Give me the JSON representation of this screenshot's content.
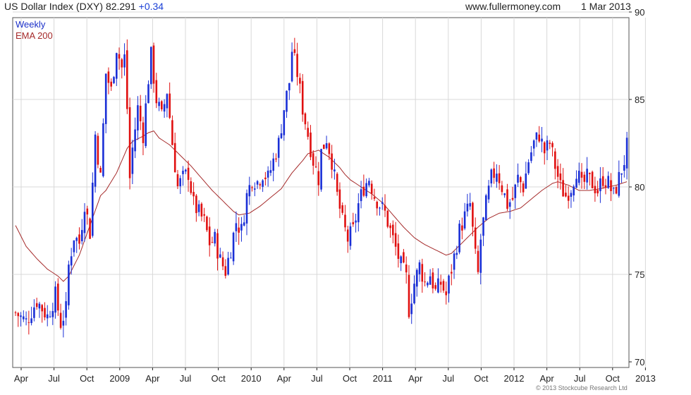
{
  "header": {
    "title": "US Dollar Index (DXY)",
    "last": "82.291",
    "change": "+0.34",
    "site": "www.fullermoney.com",
    "date": "1 Mar 2013"
  },
  "copyright": "© 2013 Stockcube Research Ltd",
  "colors": {
    "up": "#1a2fd6",
    "down": "#e01010",
    "ema": "#a52a2a",
    "grid": "#d8d8d8",
    "axis": "#222222"
  },
  "chart_data": {
    "type": "candlestick",
    "frequency": "Weekly",
    "legend": [
      "Weekly",
      "EMA 200"
    ],
    "ylim": [
      70,
      90
    ],
    "yticks": [
      70,
      75,
      80,
      85,
      90
    ],
    "xticks": [
      "Apr",
      "Jul",
      "Oct",
      "2009",
      "Apr",
      "Jul",
      "Oct",
      "2010",
      "Apr",
      "Jul",
      "Oct",
      "2011",
      "Apr",
      "Jul",
      "Oct",
      "2012",
      "Apr",
      "Jul",
      "Oct",
      "2013"
    ],
    "close_path": [
      [
        0,
        72.8
      ],
      [
        4,
        72.3
      ],
      [
        8,
        73.5
      ],
      [
        12,
        72.6
      ],
      [
        15,
        73.8
      ],
      [
        17,
        72.2
      ],
      [
        19,
        73.0
      ],
      [
        20,
        75.5
      ],
      [
        22,
        77.2
      ],
      [
        24,
        76.8
      ],
      [
        26,
        79.1
      ],
      [
        28,
        77.4
      ],
      [
        30,
        83.0
      ],
      [
        32,
        80.5
      ],
      [
        34,
        86.5
      ],
      [
        36,
        85.5
      ],
      [
        38,
        88.0
      ],
      [
        40,
        86.8
      ],
      [
        41,
        87.4
      ],
      [
        42,
        84.5
      ],
      [
        43,
        80.5
      ],
      [
        44,
        82.2
      ],
      [
        46,
        84.5
      ],
      [
        48,
        83.0
      ],
      [
        50,
        86.2
      ],
      [
        51,
        87.5
      ],
      [
        53,
        85.0
      ],
      [
        55,
        84.0
      ],
      [
        57,
        85.5
      ],
      [
        59,
        82.5
      ],
      [
        61,
        80.0
      ],
      [
        63,
        80.5
      ],
      [
        65,
        80.8
      ],
      [
        67,
        79.0
      ],
      [
        69,
        78.5
      ],
      [
        71,
        78.0
      ],
      [
        73,
        76.8
      ],
      [
        75,
        77.0
      ],
      [
        77,
        75.8
      ],
      [
        79,
        75.2
      ],
      [
        81,
        76.5
      ],
      [
        83,
        78.0
      ],
      [
        85,
        77.5
      ],
      [
        87,
        79.5
      ],
      [
        89,
        80.5
      ],
      [
        91,
        80.3
      ],
      [
        93,
        80.8
      ],
      [
        95,
        80.5
      ],
      [
        97,
        81.5
      ],
      [
        99,
        82.5
      ],
      [
        101,
        84.5
      ],
      [
        103,
        86.0
      ],
      [
        104,
        87.8
      ],
      [
        106,
        86.5
      ],
      [
        108,
        84.5
      ],
      [
        110,
        83.0
      ],
      [
        112,
        81.5
      ],
      [
        114,
        80.5
      ],
      [
        115,
        82.0
      ],
      [
        117,
        82.8
      ],
      [
        119,
        81.5
      ],
      [
        121,
        79.5
      ],
      [
        123,
        78.0
      ],
      [
        125,
        77.0
      ],
      [
        127,
        77.5
      ],
      [
        129,
        79.0
      ],
      [
        131,
        80.0
      ],
      [
        133,
        80.5
      ],
      [
        135,
        79.5
      ],
      [
        137,
        79.0
      ],
      [
        139,
        78.5
      ],
      [
        141,
        77.5
      ],
      [
        143,
        76.5
      ],
      [
        145,
        75.5
      ],
      [
        147,
        74.8
      ],
      [
        148,
        73.0
      ],
      [
        150,
        74.5
      ],
      [
        152,
        75.5
      ],
      [
        154,
        74.5
      ],
      [
        156,
        75.0
      ],
      [
        158,
        74.0
      ],
      [
        160,
        74.5
      ],
      [
        162,
        73.8
      ],
      [
        163,
        74.6
      ],
      [
        165,
        76.0
      ],
      [
        167,
        77.5
      ],
      [
        169,
        78.3
      ],
      [
        171,
        79.0
      ],
      [
        172,
        77.5
      ],
      [
        173,
        76.0
      ],
      [
        174,
        75.0
      ],
      [
        175,
        77.0
      ],
      [
        177,
        79.0
      ],
      [
        179,
        80.5
      ],
      [
        181,
        81.0
      ],
      [
        183,
        80.0
      ],
      [
        185,
        79.0
      ],
      [
        187,
        79.3
      ],
      [
        189,
        80.5
      ],
      [
        191,
        80.0
      ],
      [
        193,
        81.5
      ],
      [
        195,
        82.5
      ],
      [
        197,
        83.0
      ],
      [
        199,
        82.0
      ],
      [
        201,
        82.5
      ],
      [
        203,
        81.2
      ],
      [
        205,
        80.0
      ],
      [
        207,
        79.5
      ],
      [
        209,
        80.0
      ],
      [
        211,
        81.0
      ],
      [
        213,
        80.0
      ],
      [
        215,
        80.5
      ],
      [
        217,
        80.2
      ],
      [
        219,
        79.8
      ],
      [
        221,
        80.5
      ],
      [
        223,
        80.2
      ],
      [
        225,
        79.5
      ],
      [
        227,
        80.5
      ],
      [
        229,
        81.5
      ],
      [
        230,
        82.3
      ]
    ],
    "ema200_path": [
      [
        0,
        77.8
      ],
      [
        4,
        76.6
      ],
      [
        8,
        75.9
      ],
      [
        12,
        75.3
      ],
      [
        16,
        74.9
      ],
      [
        18,
        74.6
      ],
      [
        20,
        74.9
      ],
      [
        24,
        76.1
      ],
      [
        28,
        77.8
      ],
      [
        32,
        79.5
      ],
      [
        34,
        79.8
      ],
      [
        38,
        80.8
      ],
      [
        42,
        82.2
      ],
      [
        44,
        82.6
      ],
      [
        48,
        82.9
      ],
      [
        50,
        83.1
      ],
      [
        52,
        83.2
      ],
      [
        54,
        82.8
      ],
      [
        58,
        82.4
      ],
      [
        62,
        81.8
      ],
      [
        66,
        81.2
      ],
      [
        70,
        80.5
      ],
      [
        74,
        79.8
      ],
      [
        78,
        79.2
      ],
      [
        82,
        78.6
      ],
      [
        84,
        78.4
      ],
      [
        88,
        78.5
      ],
      [
        92,
        78.9
      ],
      [
        96,
        79.4
      ],
      [
        100,
        79.9
      ],
      [
        104,
        80.8
      ],
      [
        108,
        81.5
      ],
      [
        110,
        81.9
      ],
      [
        112,
        82.0
      ],
      [
        114,
        82.1
      ],
      [
        118,
        81.7
      ],
      [
        122,
        81.1
      ],
      [
        124,
        80.7
      ],
      [
        126,
        80.4
      ],
      [
        130,
        80.0
      ],
      [
        134,
        79.6
      ],
      [
        138,
        79.1
      ],
      [
        142,
        78.4
      ],
      [
        146,
        77.7
      ],
      [
        150,
        77.1
      ],
      [
        154,
        76.7
      ],
      [
        158,
        76.4
      ],
      [
        162,
        76.1
      ],
      [
        164,
        76.2
      ],
      [
        166,
        76.5
      ],
      [
        170,
        77.1
      ],
      [
        174,
        77.7
      ],
      [
        178,
        78.2
      ],
      [
        182,
        78.5
      ],
      [
        186,
        78.6
      ],
      [
        190,
        78.8
      ],
      [
        194,
        79.3
      ],
      [
        198,
        79.8
      ],
      [
        202,
        80.2
      ],
      [
        204,
        80.3
      ],
      [
        208,
        80.1
      ],
      [
        212,
        79.8
      ],
      [
        216,
        79.8
      ],
      [
        220,
        79.9
      ],
      [
        226,
        80.1
      ],
      [
        230,
        80.3
      ]
    ]
  }
}
